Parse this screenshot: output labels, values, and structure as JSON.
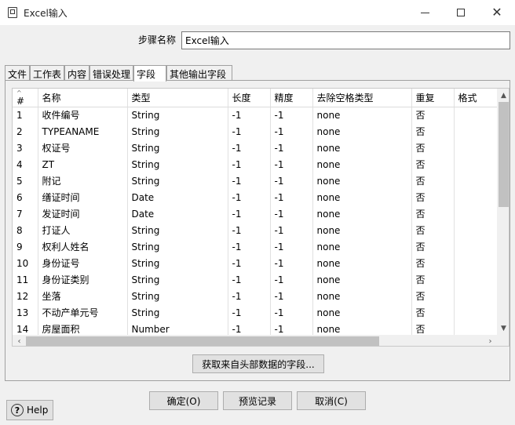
{
  "window": {
    "title": "Excel输入",
    "icon": "document-icon"
  },
  "step": {
    "label": "步骤名称",
    "value": "Excel输入"
  },
  "tabs": [
    {
      "label": "文件"
    },
    {
      "label": "工作表"
    },
    {
      "label": "内容"
    },
    {
      "label": "错误处理"
    },
    {
      "label": "字段",
      "active": true
    },
    {
      "label": "其他输出字段"
    }
  ],
  "table": {
    "headers": [
      "#",
      "名称",
      "类型",
      "长度",
      "精度",
      "去除空格类型",
      "重复",
      "格式"
    ],
    "rows": [
      [
        "1",
        "收件编号",
        "String",
        "-1",
        "-1",
        "none",
        "否",
        ""
      ],
      [
        "2",
        "TYPEANAME",
        "String",
        "-1",
        "-1",
        "none",
        "否",
        ""
      ],
      [
        "3",
        "权证号",
        "String",
        "-1",
        "-1",
        "none",
        "否",
        ""
      ],
      [
        "4",
        "ZT",
        "String",
        "-1",
        "-1",
        "none",
        "否",
        ""
      ],
      [
        "5",
        "附记",
        "String",
        "-1",
        "-1",
        "none",
        "否",
        ""
      ],
      [
        "6",
        "缮证时间",
        "Date",
        "-1",
        "-1",
        "none",
        "否",
        ""
      ],
      [
        "7",
        "发证时间",
        "Date",
        "-1",
        "-1",
        "none",
        "否",
        ""
      ],
      [
        "8",
        "打证人",
        "String",
        "-1",
        "-1",
        "none",
        "否",
        ""
      ],
      [
        "9",
        "权利人姓名",
        "String",
        "-1",
        "-1",
        "none",
        "否",
        ""
      ],
      [
        "10",
        "身份证号",
        "String",
        "-1",
        "-1",
        "none",
        "否",
        ""
      ],
      [
        "11",
        "身份证类别",
        "String",
        "-1",
        "-1",
        "none",
        "否",
        ""
      ],
      [
        "12",
        "坐落",
        "String",
        "-1",
        "-1",
        "none",
        "否",
        ""
      ],
      [
        "13",
        "不动产单元号",
        "String",
        "-1",
        "-1",
        "none",
        "否",
        ""
      ],
      [
        "14",
        "房屋面积",
        "Number",
        "-1",
        "-1",
        "none",
        "否",
        ""
      ]
    ]
  },
  "buttons": {
    "get_fields": "获取来自头部数据的字段...",
    "ok": "确定(O)",
    "preview": "预览记录",
    "cancel": "取消(C)",
    "help": "Help"
  }
}
